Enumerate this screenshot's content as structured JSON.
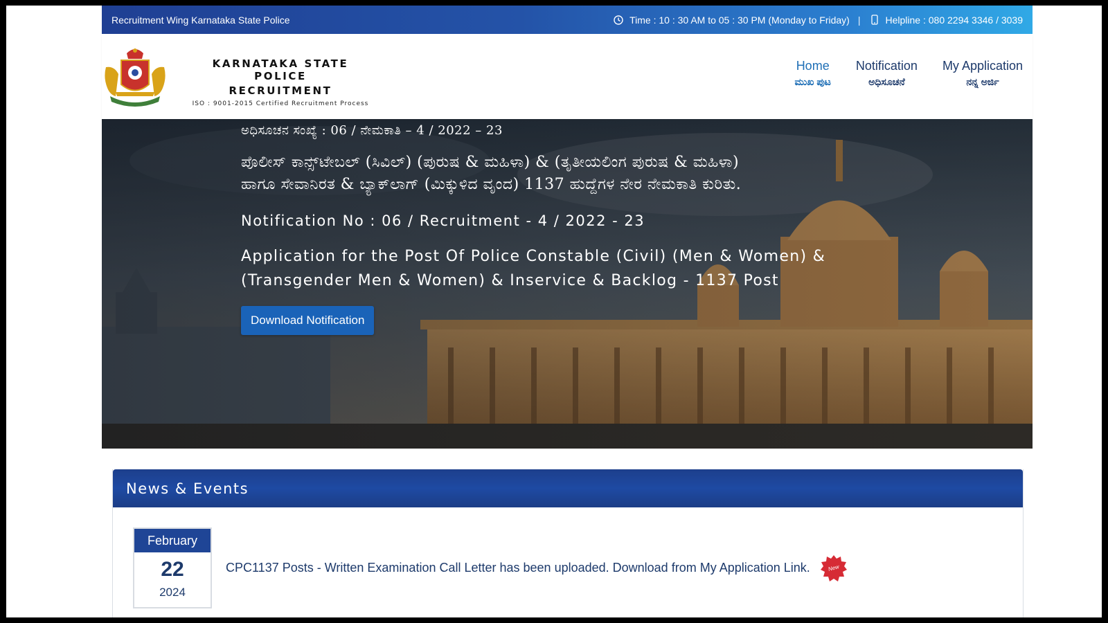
{
  "topbar": {
    "org": "Recruitment Wing Karnataka State Police",
    "time_text": "Time : 10 : 30 AM to 05 : 30 PM (Monday to Friday)",
    "separator": "|",
    "helpline_text": "Helpline : 080 2294 3346 / 3039",
    "clock_icon": "clock-icon",
    "phone_icon": "phone-icon"
  },
  "brand": {
    "line1": "KARNATAKA STATE POLICE",
    "line2": "RECRUITMENT",
    "line3": "ISO : 9001-2015 Certified Recruitment Process",
    "logo_icon": "karnataka-emblem-logo"
  },
  "nav": {
    "items": [
      {
        "en": "Home",
        "kn": "ಮುಖ ಪುಟ"
      },
      {
        "en": "Notification",
        "kn": "ಅಧಿಸೂಚನೆ"
      },
      {
        "en": "My Application",
        "kn": "ನನ್ನ ಅರ್ಜಿ"
      }
    ]
  },
  "hero": {
    "kn_notification_no": "ಅಧಿಸೂಚನ ಸಂಖ್ಯೆ : 06 / ನೇಮಕಾತಿ – 4 / 2022 – 23",
    "kn_title_line1": "ಪೊಲೀಸ್ ಕಾನ್ಸ್‌ಟೇಬಲ್ (ಸಿವಿಲ್) (ಪುರುಷ & ಮಹಿಳಾ) & (ತೃತೀಯಲಿಂಗ ಪುರುಷ & ಮಹಿಳಾ)",
    "kn_title_line2": "ಹಾಗೂ ಸೇವಾನಿರತ & ಬ್ಯಾಕ್‌ಲಾಗ್ (ಮಿಕ್ಕುಳಿದ ವೃಂದ) 1137 ಹುದ್ದೆಗಳ ನೇರ ನೇಮಕಾತಿ ಕುರಿತು.",
    "notification_no": "Notification No : 06 / Recruitment - 4 / 2022 - 23",
    "app_title_line1": "Application for the Post Of Police Constable (Civil) (Men & Women) &",
    "app_title_line2": "(Transgender Men & Women) & Inservice & Backlog - 1137 Post",
    "download_button": "Download Notification"
  },
  "news": {
    "heading": "News & Events",
    "items": [
      {
        "month": "February",
        "day": "22",
        "year": "2024",
        "text": "CPC1137 Posts - Written Examination Call Letter has been uploaded. Download from My Application Link.",
        "badge": "New"
      }
    ]
  },
  "colors": {
    "nav_active": "#1f6fb6",
    "nav_text": "#1d3a6b",
    "button_bg": "#1a63b8",
    "news_header": "#1e4aa3",
    "badge_red": "#d62b35"
  }
}
